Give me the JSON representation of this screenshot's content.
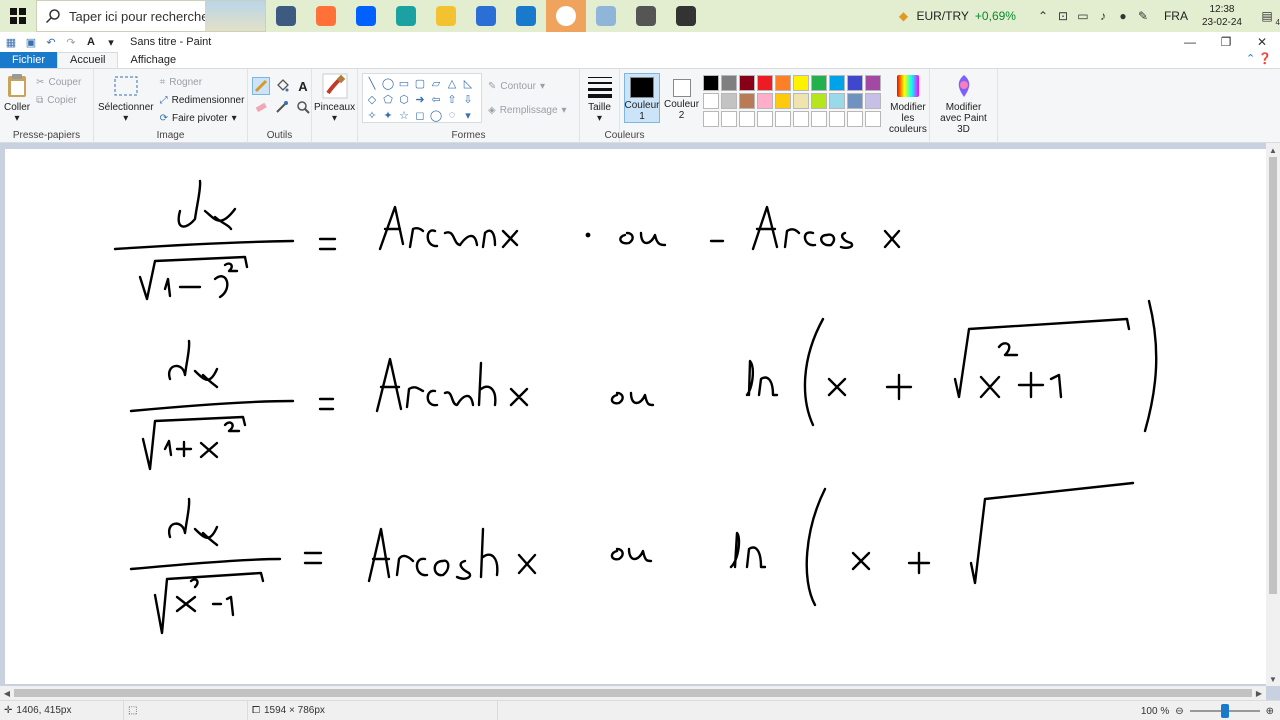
{
  "taskbar": {
    "search_placeholder": "Taper ici pour rechercher",
    "ticker_label": "EUR/TRY",
    "ticker_change": "+0,69%",
    "language": "FRA",
    "time": "12:38",
    "date": "23-02-24",
    "notifications": "4",
    "apps": [
      {
        "name": "task-view-icon",
        "color": "#3d5a80"
      },
      {
        "name": "firefox-icon",
        "color": "#ff7139"
      },
      {
        "name": "dropbox-icon",
        "color": "#0061fe"
      },
      {
        "name": "edge-icon",
        "color": "#1ba1a1"
      },
      {
        "name": "file-explorer-icon",
        "color": "#f2c230"
      },
      {
        "name": "store-icon",
        "color": "#2a6fd6"
      },
      {
        "name": "mail-icon",
        "color": "#1979ca"
      },
      {
        "name": "wordweb-icon",
        "color": "#ffffff"
      },
      {
        "name": "paint-icon",
        "color": "#8fb6d9"
      },
      {
        "name": "screen-capture-icon",
        "color": "#555555"
      },
      {
        "name": "settings-gear-icon",
        "color": "#333333"
      }
    ]
  },
  "window": {
    "title": "Sans titre - Paint"
  },
  "tabs": {
    "file": "Fichier",
    "home": "Accueil",
    "view": "Affichage"
  },
  "ribbon": {
    "clipboard": {
      "paste": "Coller",
      "cut": "Couper",
      "copy": "Copier",
      "group": "Presse-papiers"
    },
    "image": {
      "select": "Sélectionner",
      "crop": "Rogner",
      "resize": "Redimensionner",
      "rotate": "Faire pivoter",
      "group": "Image"
    },
    "tools": {
      "group": "Outils"
    },
    "brushes": {
      "label": "Pinceaux"
    },
    "shapes": {
      "outline": "Contour",
      "fill": "Remplissage",
      "group": "Formes"
    },
    "size": {
      "label": "Taille"
    },
    "colors": {
      "color1": "Couleur",
      "color1_num": "1",
      "color2": "Couleur",
      "color2_num": "2",
      "edit": "Modifier les couleurs",
      "group": "Couleurs",
      "palette": [
        "#000000",
        "#7f7f7f",
        "#880015",
        "#ed1c24",
        "#ff7f27",
        "#fff200",
        "#22b14c",
        "#00a2e8",
        "#3f48cc",
        "#a349a4",
        "#ffffff",
        "#c3c3c3",
        "#b97a57",
        "#ffaec9",
        "#ffc90e",
        "#efe4b0",
        "#b5e61d",
        "#99d9ea",
        "#7092be",
        "#c8bfe7",
        "#ffffff",
        "#ffffff",
        "#ffffff",
        "#ffffff",
        "#ffffff",
        "#ffffff",
        "#ffffff",
        "#ffffff",
        "#ffffff",
        "#ffffff"
      ]
    },
    "paint3d": {
      "label": "Modifier avec Paint 3D"
    }
  },
  "status": {
    "cursor_pos": "1406, 415px",
    "canvas_size": "1594 × 786px",
    "zoom": "100 %"
  }
}
